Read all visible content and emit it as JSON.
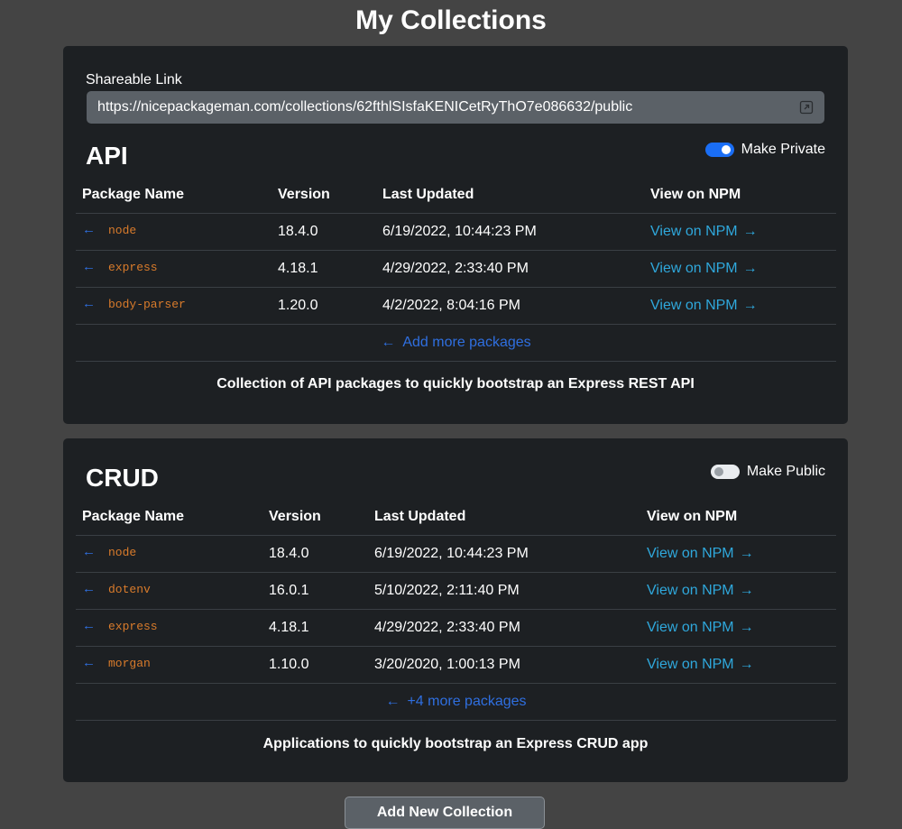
{
  "page": {
    "title": "My Collections"
  },
  "colors": {
    "background": "#444444",
    "card": "#1d2023",
    "package_name": "#d97b2b",
    "link": "#2fa8dc",
    "accent_blue": "#1a6ef5"
  },
  "table_headers": {
    "name": "Package Name",
    "version": "Version",
    "updated": "Last Updated",
    "npm": "View on NPM"
  },
  "icons": {
    "remove": "arrow-left-icon",
    "external": "arrow-right-icon",
    "open": "external-link-icon"
  },
  "collections": [
    {
      "shareable_label": "Shareable Link",
      "shareable_url": "https://nicepackageman.com/collections/62fthlSIsfaKENICetRyThO7e086632/public",
      "title": "API",
      "toggle_label": "Make Private",
      "toggle_on": true,
      "packages": [
        {
          "name": "node",
          "version": "18.4.0",
          "updated": "6/19/2022, 10:44:23 PM",
          "npm": "View on NPM"
        },
        {
          "name": "express",
          "version": "4.18.1",
          "updated": "4/29/2022, 2:33:40 PM",
          "npm": "View on NPM"
        },
        {
          "name": "body-parser",
          "version": "1.20.0",
          "updated": "4/2/2022, 8:04:16 PM",
          "npm": "View on NPM"
        }
      ],
      "more_label": "Add more packages",
      "description": "Collection of API packages to quickly bootstrap an Express REST API"
    },
    {
      "title": "CRUD",
      "toggle_label": "Make Public",
      "toggle_on": false,
      "packages": [
        {
          "name": "node",
          "version": "18.4.0",
          "updated": "6/19/2022, 10:44:23 PM",
          "npm": "View on NPM"
        },
        {
          "name": "dotenv",
          "version": "16.0.1",
          "updated": "5/10/2022, 2:11:40 PM",
          "npm": "View on NPM"
        },
        {
          "name": "express",
          "version": "4.18.1",
          "updated": "4/29/2022, 2:33:40 PM",
          "npm": "View on NPM"
        },
        {
          "name": "morgan",
          "version": "1.10.0",
          "updated": "3/20/2020, 1:00:13 PM",
          "npm": "View on NPM"
        }
      ],
      "more_label": "+4 more packages",
      "description": "Applications to quickly bootstrap an Express CRUD app"
    }
  ],
  "add_button_label": "Add New Collection"
}
